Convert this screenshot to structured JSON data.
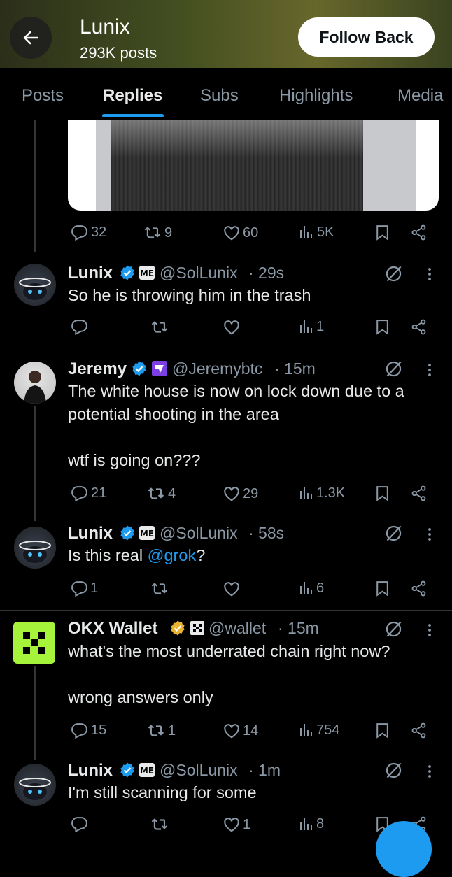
{
  "header": {
    "title": "Lunix",
    "subtitle": "293K posts",
    "follow_label": "Follow Back"
  },
  "tabs": [
    {
      "label": "Posts"
    },
    {
      "label": "Replies"
    },
    {
      "label": "Subs"
    },
    {
      "label": "Highlights"
    },
    {
      "label": "Media"
    }
  ],
  "colors": {
    "accent": "#1d9bf0",
    "verified_blue": "#1d9bf0",
    "verified_gold": "#e9b32d",
    "okx_green": "#a6f33b"
  },
  "top_actions": {
    "replies": "32",
    "reposts": "9",
    "likes": "60",
    "views": "5K"
  },
  "posts": [
    {
      "name": "Lunix",
      "handle": "@SolLunix",
      "time": "· 29s",
      "text": "So he is throwing him in the trash",
      "replies": "",
      "reposts": "",
      "likes": "",
      "views": "1"
    },
    {
      "name": "Jeremy",
      "handle": "@Jeremybtc",
      "time": "· 15m",
      "text": "The white house is now on lock down due to a\npotential shooting in the area\n\nwtf is going on???",
      "replies": "21",
      "reposts": "4",
      "likes": "29",
      "views": "1.3K"
    },
    {
      "name": "Lunix",
      "handle": "@SolLunix",
      "time": "· 58s",
      "text_prefix": "Is this real ",
      "mention": "@grok",
      "text_suffix": "?",
      "replies": "1",
      "reposts": "",
      "likes": "",
      "views": "6"
    },
    {
      "name": "OKX Wallet",
      "handle": "@wallet",
      "time": "· 15m",
      "text": "what's the most underrated chain right now?\n\nwrong answers only",
      "replies": "15",
      "reposts": "1",
      "likes": "14",
      "views": "754"
    },
    {
      "name": "Lunix",
      "handle": "@SolLunix",
      "time": "· 1m",
      "text": "I'm still scanning for some",
      "replies": "",
      "reposts": "",
      "likes": "1",
      "views": "8"
    }
  ]
}
